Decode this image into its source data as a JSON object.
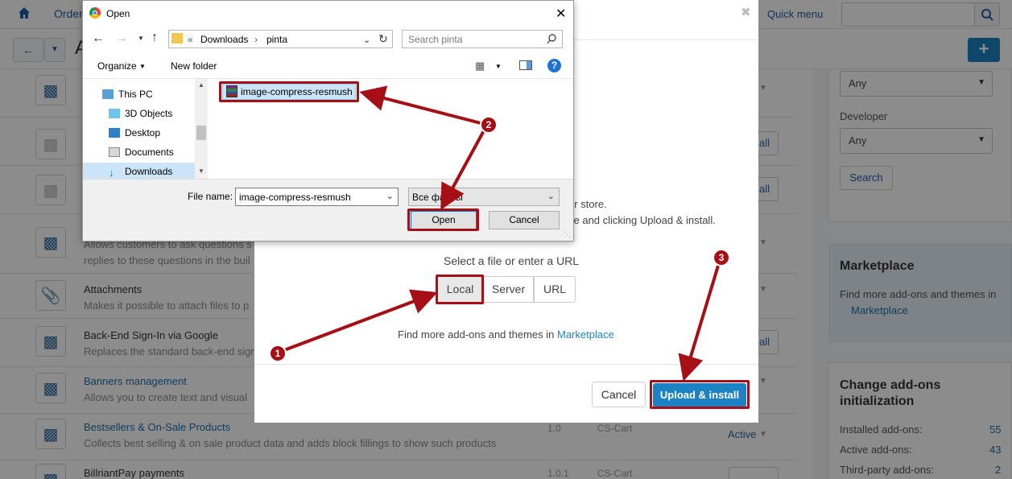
{
  "header": {
    "nav_orders": "Orders",
    "quick_menu": "Quick menu",
    "page_title_letter": "A"
  },
  "addons": [
    {
      "title": "",
      "desc": "",
      "status": "",
      "version": "",
      "developer": ""
    },
    {
      "title": "",
      "desc": "",
      "install": "all"
    },
    {
      "title": "",
      "desc": "",
      "install": "all"
    },
    {
      "title": "",
      "desc_line1": "Allows customers to ask questions s",
      "desc_line2": "replies to these questions in the buil"
    },
    {
      "title": "Attachments",
      "desc": "Makes it possible to attach files to p"
    },
    {
      "title": "Back-End Sign-In via Google",
      "desc": "Replaces the standard back-end sign",
      "install": "all"
    },
    {
      "title": "Banners management",
      "desc": "Allows you to create text and visual"
    },
    {
      "title": "Bestsellers & On-Sale Products",
      "desc": "Collects best selling & on sale product data and adds block fillings to show such products",
      "version": "1.0",
      "developer": "CS-Cart",
      "status": "Active"
    },
    {
      "title": "BillriantPay payments",
      "version": "1.0.1",
      "developer": "CS-Cart"
    }
  ],
  "sidebar": {
    "filter_any_1": "Any",
    "developer_label": "Developer",
    "filter_any_2": "Any",
    "search_button": "Search",
    "marketplace_title": "Marketplace",
    "marketplace_text": "Find more add-ons and themes in",
    "marketplace_link": "Marketplace",
    "init_title_line1": "Change add-ons",
    "init_title_line2": "initialization",
    "stats": [
      {
        "label": "Installed add-ons:",
        "value": "55"
      },
      {
        "label": "Active add-ons:",
        "value": "43"
      },
      {
        "label": "Third-party add-ons:",
        "value": "2"
      }
    ]
  },
  "modal": {
    "text_line1": "ur store.",
    "text_line2": "ve and clicking Upload & install.",
    "select_label": "Select a file or enter a URL",
    "source_tabs": [
      "Local",
      "Server",
      "URL"
    ],
    "find_more": "Find more add-ons and themes in",
    "find_more_link": "Marketplace",
    "cancel": "Cancel",
    "upload_install": "Upload & install"
  },
  "file_dialog": {
    "title": "Open",
    "path": [
      "«",
      "Downloads",
      "›",
      "pinta"
    ],
    "search_placeholder": "Search pinta",
    "organize": "Organize",
    "new_folder": "New folder",
    "nav_items": [
      {
        "label": "This PC",
        "icon": "pc-icon"
      },
      {
        "label": "3D Objects",
        "icon": "cube-icon"
      },
      {
        "label": "Desktop",
        "icon": "desktop-icon"
      },
      {
        "label": "Documents",
        "icon": "documents-icon"
      },
      {
        "label": "Downloads",
        "icon": "download-icon"
      }
    ],
    "file_item": "image-compress-resmush",
    "filename_label": "File name:",
    "filename_value": "image-compress-resmush",
    "filetype": "Все файлы",
    "open_button": "Open",
    "cancel_button": "Cancel"
  },
  "callouts": [
    "1",
    "2",
    "3"
  ],
  "colors": {
    "accent": "#1d82c4",
    "highlight": "#a50f15"
  }
}
